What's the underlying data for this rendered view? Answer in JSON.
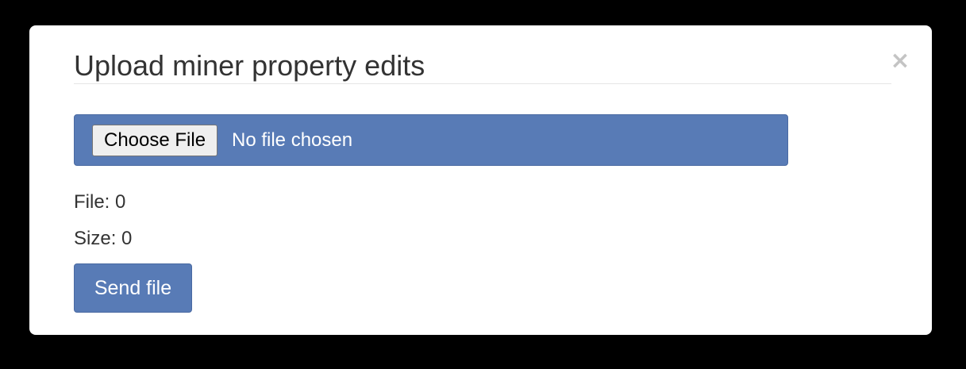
{
  "modal": {
    "title": "Upload miner property edits",
    "close_symbol": "×"
  },
  "file_input": {
    "button_label": "Choose File",
    "status_text": "No file chosen"
  },
  "info": {
    "file_label": "File:",
    "file_value": "0",
    "size_label": "Size:",
    "size_value": "0"
  },
  "actions": {
    "send_label": "Send file"
  },
  "colors": {
    "accent": "#587bb6",
    "backdrop": "#000000",
    "panel": "#ffffff",
    "close_icon": "#c4c4c4"
  },
  "icons": {
    "close": "close-icon"
  }
}
